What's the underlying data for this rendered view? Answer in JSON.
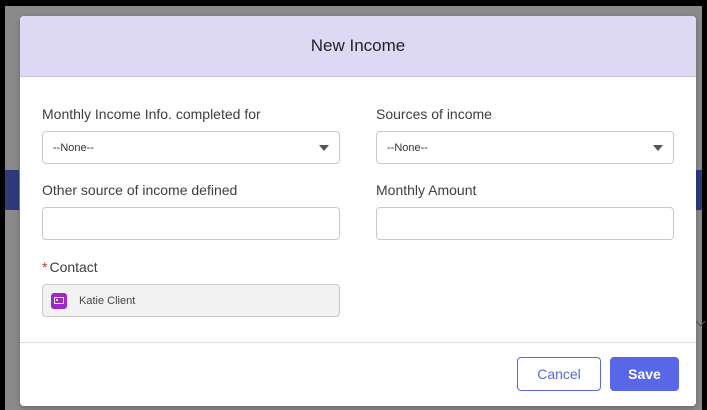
{
  "modal": {
    "title": "New Income"
  },
  "form": {
    "monthly_info": {
      "label": "Monthly Income Info. completed for",
      "value": "--None--"
    },
    "sources": {
      "label": "Sources of income",
      "value": "--None--"
    },
    "other_source": {
      "label": "Other source of income defined",
      "value": ""
    },
    "monthly_amount": {
      "label": "Monthly Amount",
      "value": ""
    },
    "contact": {
      "label": "Contact",
      "required_marker": "*",
      "value": "Katie Client",
      "icon": "contact-card-icon"
    }
  },
  "footer": {
    "cancel_label": "Cancel",
    "save_label": "Save"
  },
  "colors": {
    "header_bg": "#ddd9f5",
    "brand": "#5867e8",
    "contact_icon": "#9c29c4",
    "required": "#c23934"
  }
}
